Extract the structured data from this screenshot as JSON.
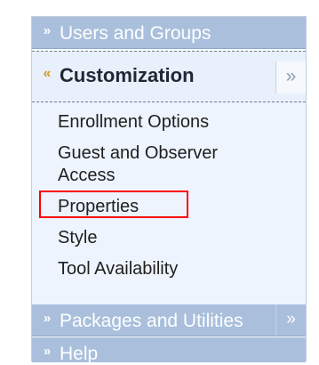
{
  "menu": {
    "users_groups": {
      "label": "Users and Groups",
      "icon": "chevron-down-icon"
    },
    "customization": {
      "label": "Customization",
      "icon": "chevron-up-icon",
      "expand_icon": "double-chevron-right-icon",
      "items": [
        "Enrollment Options",
        "Guest and Observer Access",
        "Properties",
        "Style",
        "Tool Availability"
      ]
    },
    "packages_utilities": {
      "label": "Packages and Utilities",
      "icon": "chevron-down-icon",
      "expand_icon": "double-chevron-right-icon"
    },
    "help": {
      "label": "Help",
      "icon": "chevron-down-icon"
    }
  },
  "icons": {
    "chevron_down": "»",
    "chevron_up": "«",
    "double_right": "»"
  },
  "colors": {
    "header_blue": "#a9bfdc",
    "content_blue": "#edf4fd",
    "highlight_red": "#ff0000",
    "accent_gold": "#d39a23"
  }
}
